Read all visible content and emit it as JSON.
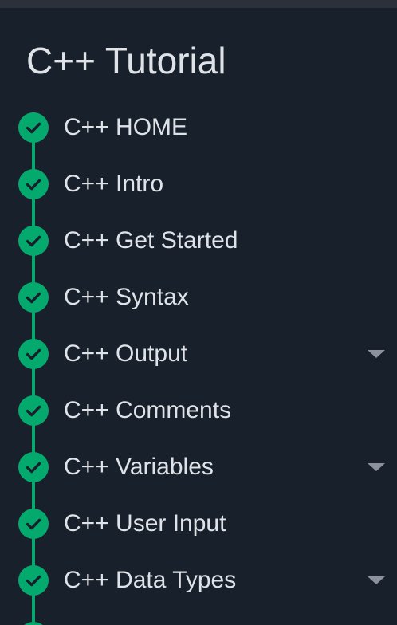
{
  "sidebar": {
    "title": "C++ Tutorial",
    "accent_color": "#04aa6d",
    "items": [
      {
        "label": "C++ HOME",
        "icon": "check-circle-icon",
        "has_submenu": false
      },
      {
        "label": "C++ Intro",
        "icon": "check-circle-icon",
        "has_submenu": false
      },
      {
        "label": "C++ Get Started",
        "icon": "check-circle-icon",
        "has_submenu": false
      },
      {
        "label": "C++ Syntax",
        "icon": "check-circle-icon",
        "has_submenu": false
      },
      {
        "label": "C++ Output",
        "icon": "check-circle-icon",
        "has_submenu": true
      },
      {
        "label": "C++ Comments",
        "icon": "check-circle-icon",
        "has_submenu": false
      },
      {
        "label": "C++ Variables",
        "icon": "check-circle-icon",
        "has_submenu": true
      },
      {
        "label": "C++ User Input",
        "icon": "check-circle-icon",
        "has_submenu": false
      },
      {
        "label": "C++ Data Types",
        "icon": "check-circle-icon",
        "has_submenu": true
      }
    ]
  }
}
